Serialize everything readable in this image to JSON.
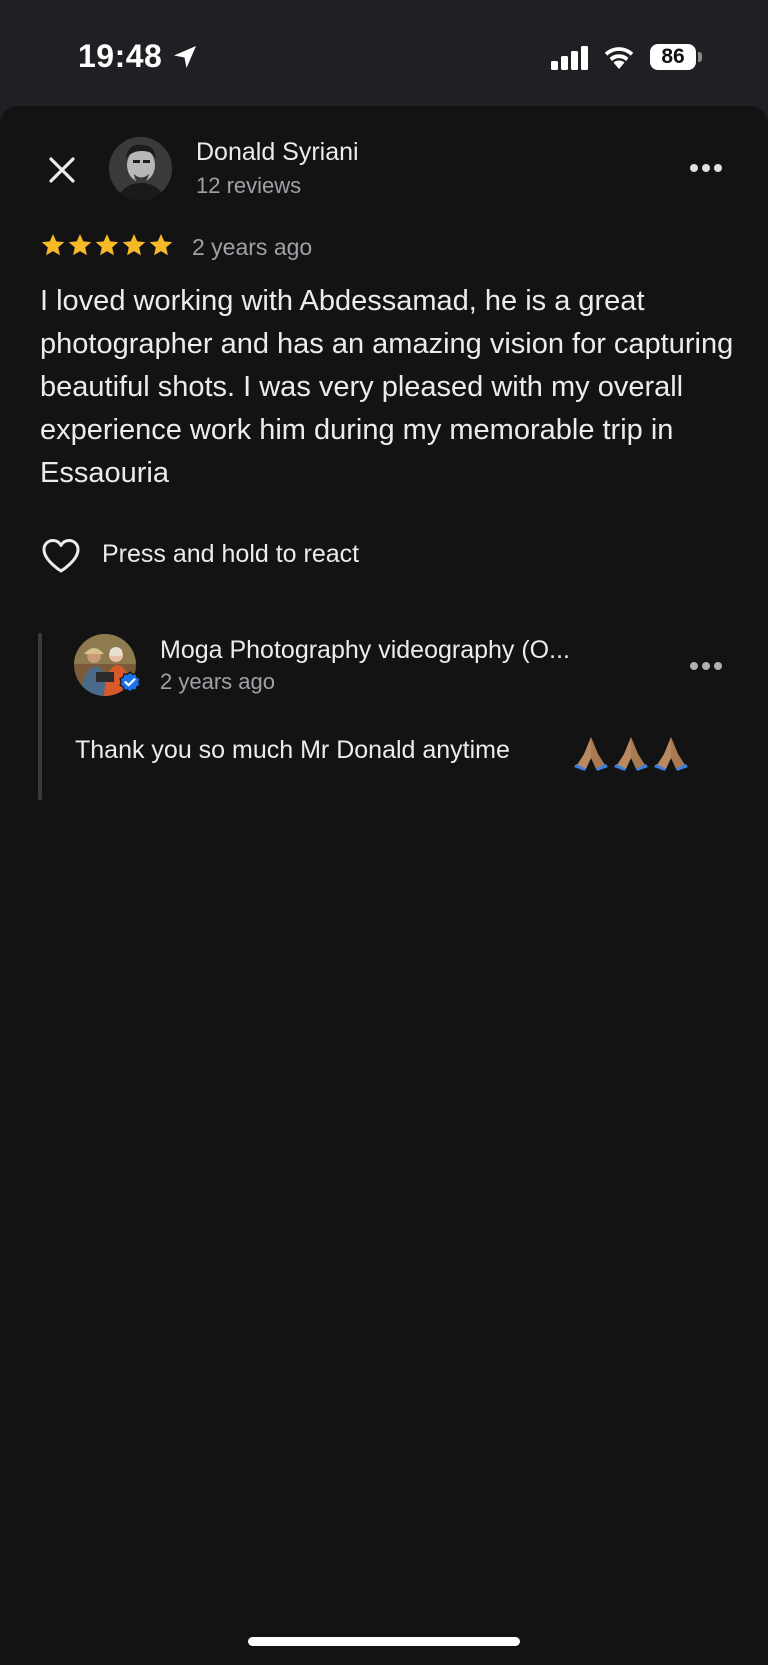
{
  "status_bar": {
    "time": "19:48",
    "battery": "86"
  },
  "review": {
    "reviewer_name": "Donald Syriani",
    "reviewer_meta": "12 reviews",
    "rating": 5,
    "rating_max": 5,
    "date": "2 years ago",
    "text": "I loved working with Abdessamad, he is a great photographer and has an amazing vision for capturing beautiful shots. I was very pleased with my overall experience work him during my memorable trip in Essaouria",
    "react_label": "Press and hold to react"
  },
  "owner_reply": {
    "name": "Moga Photography videography (O...",
    "date": "2 years ago",
    "text": "Thank you so much Mr Donald anytime",
    "emoji_count": 3
  },
  "colors": {
    "background": "#131314",
    "status_bar": "#1f2024",
    "star": "#f7b928",
    "verified": "#1a73e8",
    "primary_text": "#ececee",
    "secondary_text": "#a0a0a6"
  },
  "icons": {
    "location": "location-arrow-icon",
    "signal": "cellular-signal-icon",
    "wifi": "wifi-icon",
    "close": "close-icon",
    "more": "more-horizontal-icon",
    "star": "star-icon",
    "heart": "heart-outline-icon",
    "verified": "verified-badge-icon",
    "emoji": "folded-hands-emoji-icon"
  }
}
